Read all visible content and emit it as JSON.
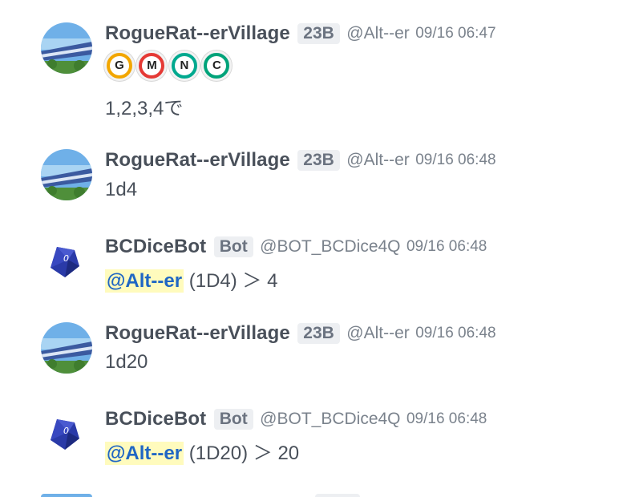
{
  "colors": {
    "mention_bg": "#fffbbd",
    "mention_text": "#1f66c4",
    "stamp_g": "#f2a600",
    "stamp_m": "#e53935",
    "stamp_n": "#00a98f",
    "stamp_c": "#00a37a"
  },
  "messages": [
    {
      "author": "RogueRat--erVillage",
      "tag": "23B",
      "handle": "@Alt--er",
      "time": "09/16 06:47",
      "stamps": [
        "G",
        "M",
        "N",
        "C"
      ],
      "text": "1,2,3,4で"
    },
    {
      "author": "RogueRat--erVillage",
      "tag": "23B",
      "handle": "@Alt--er",
      "time": "09/16 06:48",
      "text": "1d4"
    },
    {
      "author": "BCDiceBot",
      "tag": "Bot",
      "handle": "@BOT_BCDice4Q",
      "time": "09/16 06:48",
      "mention": "@Alt--er",
      "text": " (1D4) ＞ 4"
    },
    {
      "author": "RogueRat--erVillage",
      "tag": "23B",
      "handle": "@Alt--er",
      "time": "09/16 06:48",
      "text": "1d20"
    },
    {
      "author": "BCDiceBot",
      "tag": "Bot",
      "handle": "@BOT_BCDice4Q",
      "time": "09/16 06:48",
      "mention": "@Alt--er",
      "text": " (1D20) ＞ 20"
    }
  ]
}
